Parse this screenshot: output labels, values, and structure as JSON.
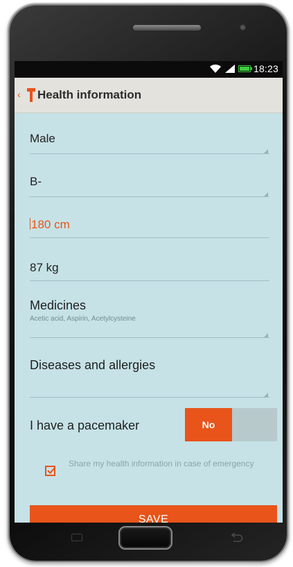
{
  "status_bar": {
    "time": "18:23",
    "icons": [
      "wifi-icon",
      "signal-icon",
      "battery-icon"
    ]
  },
  "action_bar": {
    "back_icon": "chevron-left-icon",
    "logo_icon": "app-logo-icon",
    "title": "Health information"
  },
  "form": {
    "gender": {
      "value": "Male"
    },
    "blood_type": {
      "value": "B-"
    },
    "height": {
      "value": "180 cm"
    },
    "weight": {
      "value": "87 kg"
    },
    "medicines": {
      "label": "Medicines",
      "value": "Acetic acid, Aspirin, Acetylcysteine"
    },
    "diseases": {
      "label": "Diseases and allergies",
      "value": ""
    },
    "pacemaker": {
      "label": "I have a pacemaker",
      "toggle_label": "No"
    },
    "share": {
      "checked": true,
      "label": "Share my health information in case of emergency"
    },
    "save_label": "SAVE"
  },
  "nav_bar": {
    "icons": [
      "menu-icon",
      "home-icon",
      "back-icon"
    ]
  },
  "colors": {
    "accent": "#e8541a",
    "screen_background": "#c6e2e6",
    "action_bar": "#e4e2dd"
  }
}
